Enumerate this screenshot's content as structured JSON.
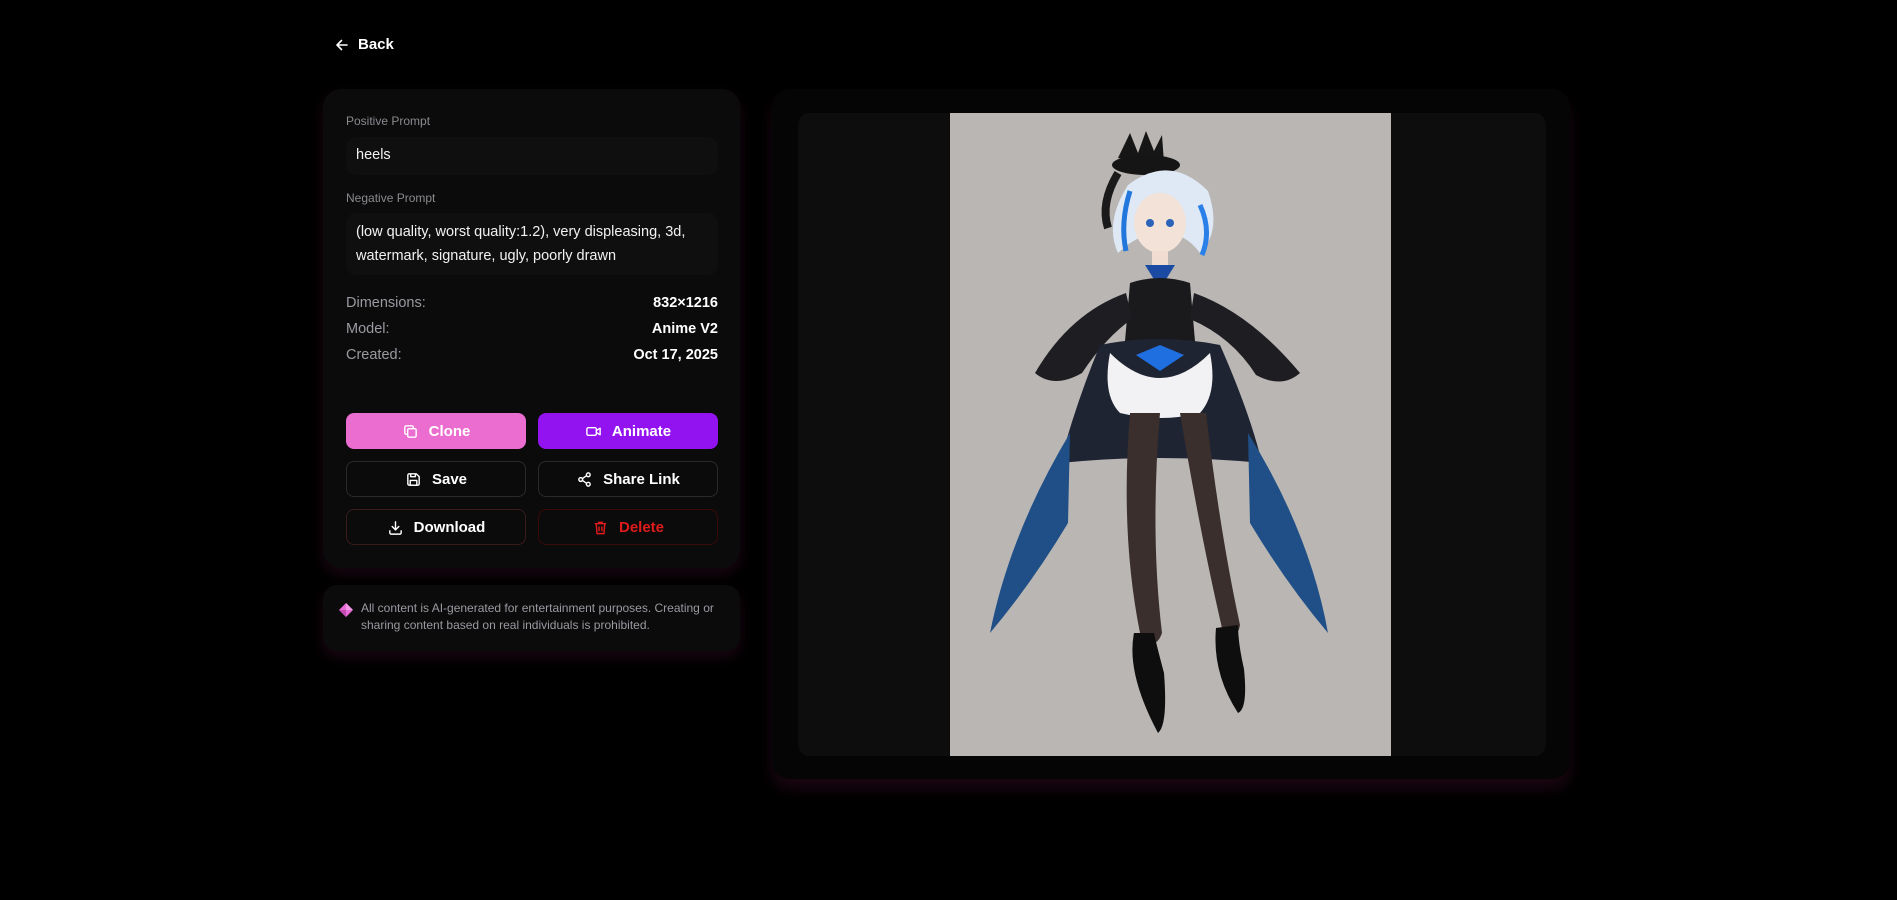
{
  "nav": {
    "back_label": "Back"
  },
  "prompts": {
    "positive_label": "Positive Prompt",
    "positive_value": "heels",
    "negative_label": "Negative Prompt",
    "negative_value": "(low quality, worst quality:1.2), very displeasing, 3d, watermark, signature, ugly, poorly drawn"
  },
  "meta": {
    "dimensions_label": "Dimensions:",
    "dimensions_value": "832×1216",
    "model_label": "Model:",
    "model_value": "Anime V2",
    "created_label": "Created:",
    "created_value": "Oct 17, 2025"
  },
  "actions": {
    "clone": "Clone",
    "animate": "Animate",
    "save": "Save",
    "share": "Share Link",
    "download": "Download",
    "delete": "Delete"
  },
  "notice": {
    "text": "All content is AI-generated for entertainment purposes. Creating or sharing content based on real individuals is prohibited."
  },
  "colors": {
    "clone_bg": "#ec6dd0",
    "animate_bg": "#9313f0",
    "delete_text": "#e01b1b",
    "image_bg": "#b9b6b4"
  },
  "icons": {
    "back": "arrow-left-icon",
    "clone": "copy-icon",
    "animate": "video-icon",
    "save": "floppy-disk-icon",
    "share": "share-icon",
    "download": "download-icon",
    "delete": "trash-icon",
    "notice": "diamond-gem-icon"
  }
}
